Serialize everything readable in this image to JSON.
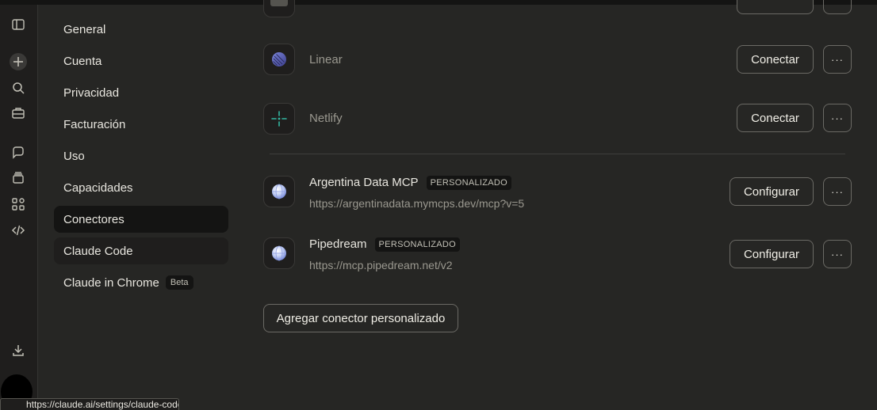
{
  "nav": {
    "items": [
      {
        "label": "General"
      },
      {
        "label": "Cuenta"
      },
      {
        "label": "Privacidad"
      },
      {
        "label": "Facturación"
      },
      {
        "label": "Uso"
      },
      {
        "label": "Capacidades"
      },
      {
        "label": "Conectores"
      },
      {
        "label": "Claude Code"
      },
      {
        "label": "Claude in Chrome",
        "badge": "Beta"
      }
    ],
    "active": "Conectores"
  },
  "connectors": {
    "builtin": [
      {
        "name": "Linear",
        "action": "Conectar",
        "icon": "linear-logo"
      },
      {
        "name": "Netlify",
        "action": "Conectar",
        "icon": "netlify-logo"
      }
    ],
    "custom": [
      {
        "name": "Argentina Data MCP",
        "badge": "PERSONALIZADO",
        "url": "https://argentinadata.mymcps.dev/mcp?v=5",
        "action": "Configurar",
        "icon": "globe-icon"
      },
      {
        "name": "Pipedream",
        "badge": "PERSONALIZADO",
        "url": "https://mcp.pipedream.net/v2",
        "action": "Configurar",
        "icon": "globe-icon"
      }
    ],
    "more_label": "···",
    "add_label": "Agregar conector personalizado"
  },
  "status_url": "https://claude.ai/settings/claude-code",
  "colors": {
    "background": "#262624",
    "sidebar": "#1f1e1d",
    "active_nav": "#141413",
    "text": "#e8e6df",
    "muted": "#9a988f",
    "netlify": "#32b7a1"
  }
}
